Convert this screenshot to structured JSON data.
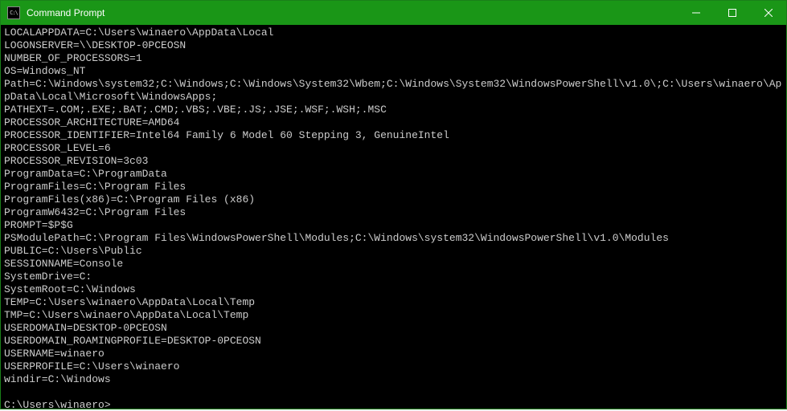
{
  "titlebar": {
    "icon_label": "C:\\",
    "title": "Command Prompt"
  },
  "terminal": {
    "lines": [
      "LOCALAPPDATA=C:\\Users\\winaero\\AppData\\Local",
      "LOGONSERVER=\\\\DESKTOP-0PCEOSN",
      "NUMBER_OF_PROCESSORS=1",
      "OS=Windows_NT",
      "Path=C:\\Windows\\system32;C:\\Windows;C:\\Windows\\System32\\Wbem;C:\\Windows\\System32\\WindowsPowerShell\\v1.0\\;C:\\Users\\winaero\\AppData\\Local\\Microsoft\\WindowsApps;",
      "PATHEXT=.COM;.EXE;.BAT;.CMD;.VBS;.VBE;.JS;.JSE;.WSF;.WSH;.MSC",
      "PROCESSOR_ARCHITECTURE=AMD64",
      "PROCESSOR_IDENTIFIER=Intel64 Family 6 Model 60 Stepping 3, GenuineIntel",
      "PROCESSOR_LEVEL=6",
      "PROCESSOR_REVISION=3c03",
      "ProgramData=C:\\ProgramData",
      "ProgramFiles=C:\\Program Files",
      "ProgramFiles(x86)=C:\\Program Files (x86)",
      "ProgramW6432=C:\\Program Files",
      "PROMPT=$P$G",
      "PSModulePath=C:\\Program Files\\WindowsPowerShell\\Modules;C:\\Windows\\system32\\WindowsPowerShell\\v1.0\\Modules",
      "PUBLIC=C:\\Users\\Public",
      "SESSIONNAME=Console",
      "SystemDrive=C:",
      "SystemRoot=C:\\Windows",
      "TEMP=C:\\Users\\winaero\\AppData\\Local\\Temp",
      "TMP=C:\\Users\\winaero\\AppData\\Local\\Temp",
      "USERDOMAIN=DESKTOP-0PCEOSN",
      "USERDOMAIN_ROAMINGPROFILE=DESKTOP-0PCEOSN",
      "USERNAME=winaero",
      "USERPROFILE=C:\\Users\\winaero",
      "windir=C:\\Windows"
    ],
    "prompt": "C:\\Users\\winaero>"
  }
}
